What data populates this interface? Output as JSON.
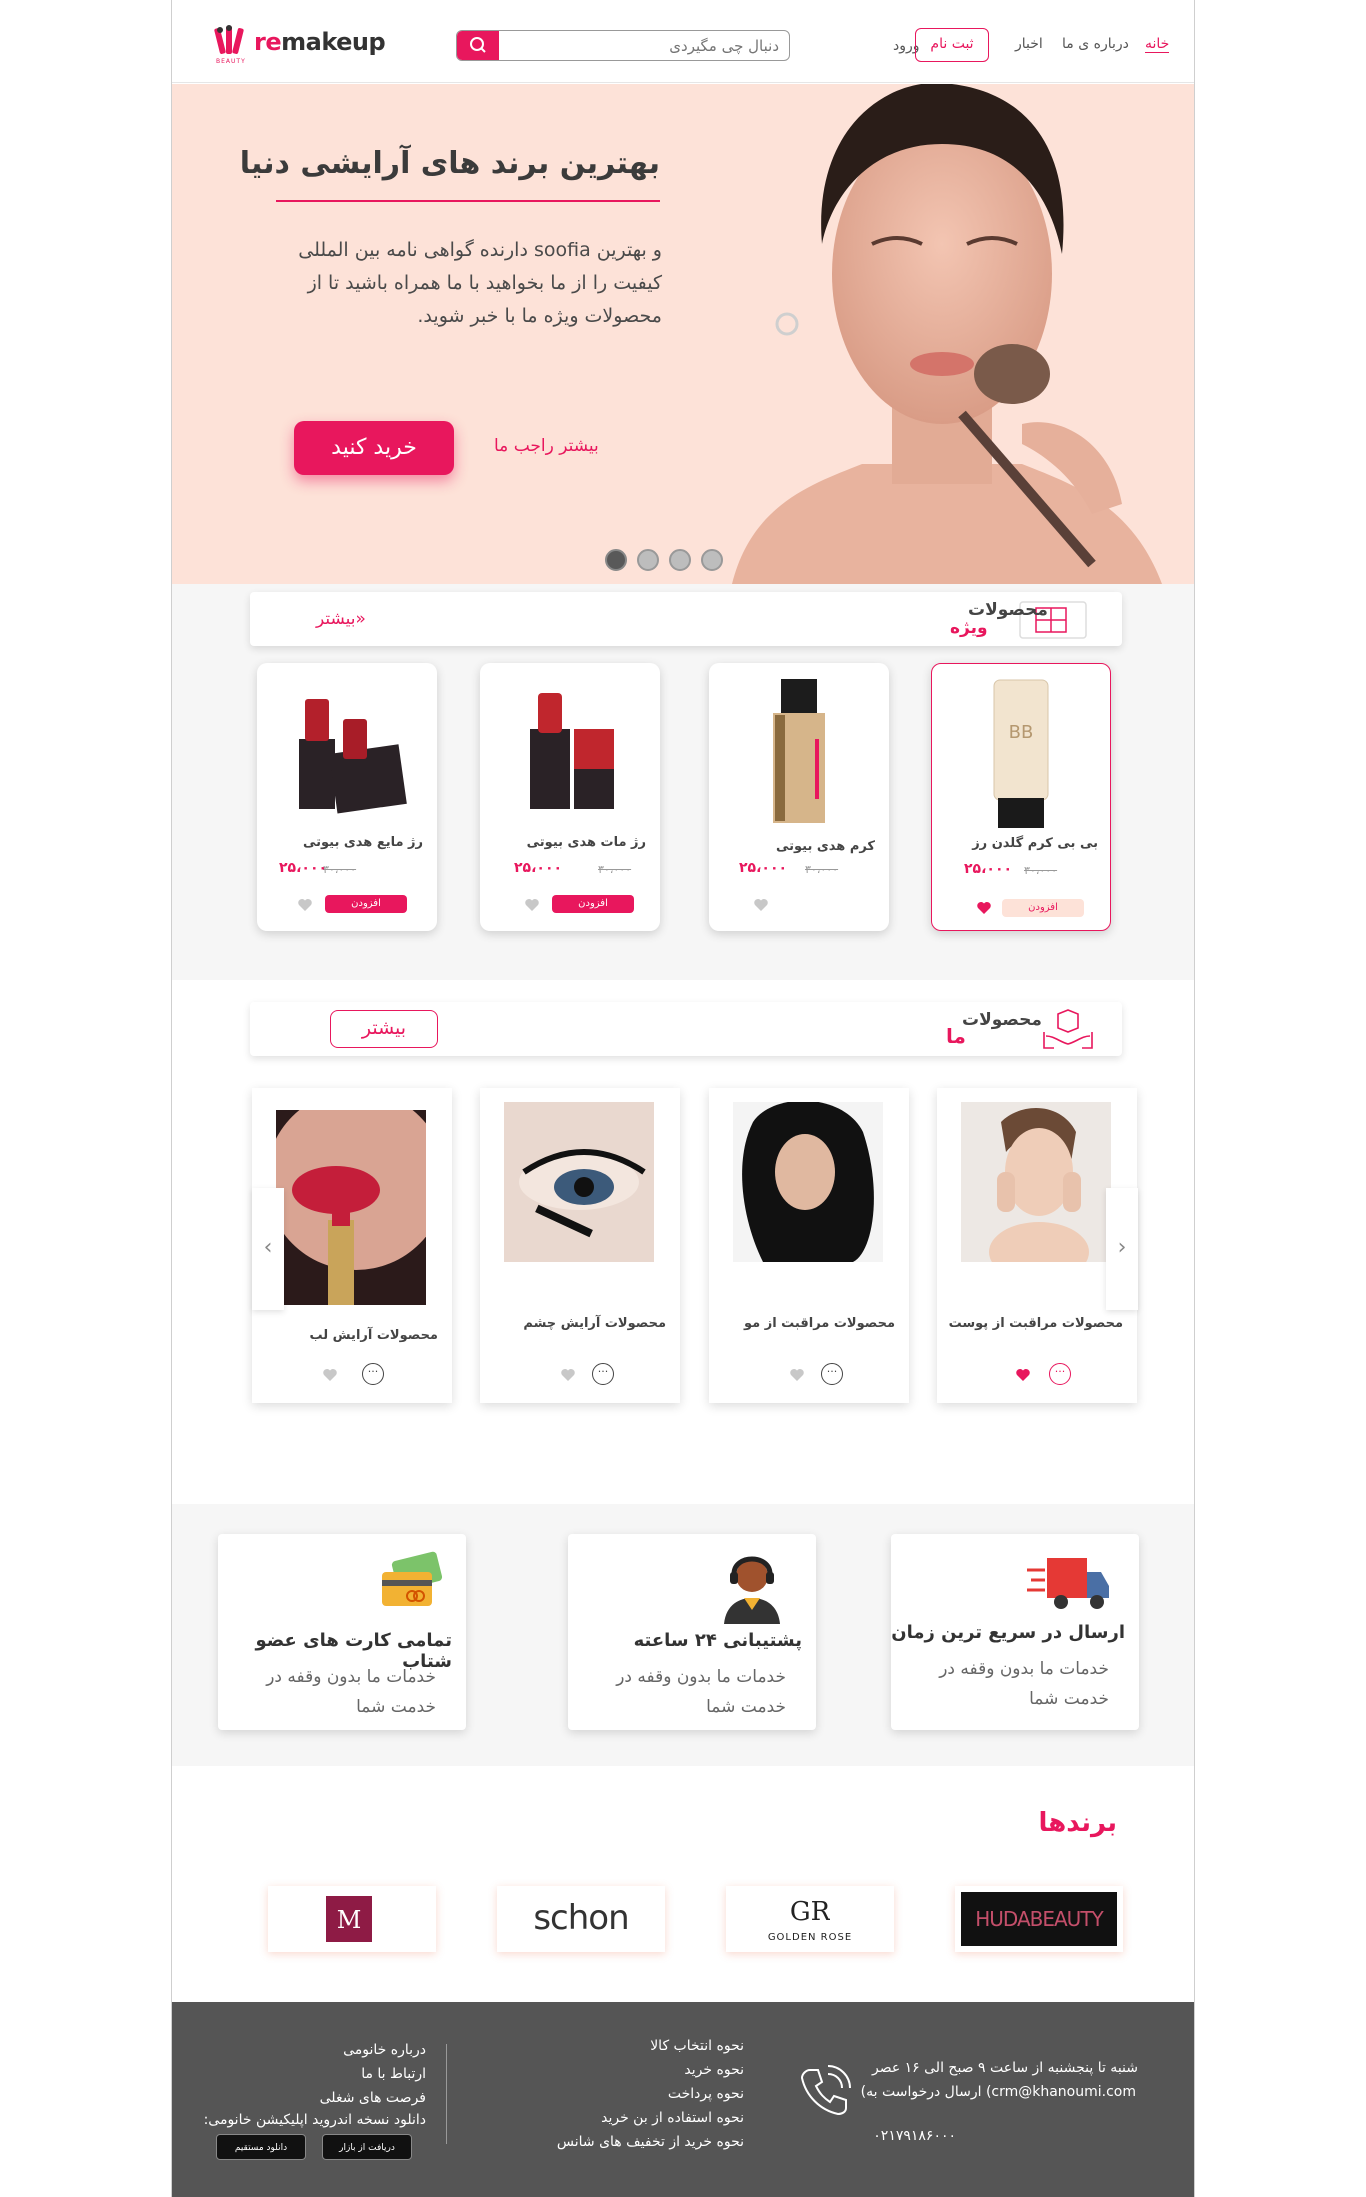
{
  "header": {
    "logo_re": "re",
    "logo_rest": "makeup",
    "logo_sub": "BEAUTY",
    "search_placeholder": "دنبال چی مگیردی",
    "nav": {
      "home": "خانه",
      "about": "درباره ی ما",
      "news": "اخبار",
      "signup": "ثبت نام",
      "login": "ورود"
    }
  },
  "hero": {
    "title": "بهترین برند های آرایشی دنیا",
    "description": "و بهترین soofia دارنده گواهی نامه بین المللی کیفیت را از ما بخواهید با ما همراه باشید تا از محصولات ویژه ما با خبر شوید.",
    "buy_button": "خرید کنید",
    "more_link": "بیشتر راجب ما",
    "slides": 4,
    "active_slide": 1
  },
  "special": {
    "title_1": "محصولات",
    "title_2": "ویژه",
    "more": "بیشتر»",
    "products": [
      {
        "name": "رژ مایع هدی بیوتی",
        "old_price": "۳۰،۰۰۰",
        "new_price": "۲۵،۰۰۰",
        "add": "افزودن",
        "liked": false
      },
      {
        "name": "رژ مات هدی بیوتی",
        "old_price": "۳۰،۰۰۰",
        "new_price": "۲۵،۰۰۰",
        "add": "افزودن",
        "liked": false
      },
      {
        "name": "کرم هدی بیوتی",
        "old_price": "۳۰،۰۰۰",
        "new_price": "۲۵،۰۰۰",
        "add": "",
        "liked": false
      },
      {
        "name": "بی بی کرم گلدن رز",
        "old_price": "۳۰،۰۰۰",
        "new_price": "۲۵،۰۰۰",
        "add": "افزودن",
        "liked": true
      }
    ]
  },
  "ours": {
    "title_1": "محصولات",
    "title_2": "ما",
    "more": "بیشتر",
    "categories": [
      {
        "name": "محصولات آرایش لب",
        "liked": false
      },
      {
        "name": "محصولات آرایش چشم",
        "liked": false
      },
      {
        "name": "محصولات مراقبت از مو",
        "liked": false
      },
      {
        "name": "محصولات مراقبت از پوست",
        "liked": true
      }
    ],
    "more_glyph": "···",
    "prev": "‹",
    "next": "›"
  },
  "features": [
    {
      "title": "تمامی کارت های عضو شتاب",
      "desc": "خدمات ما بدون وقفه در خدمت شما"
    },
    {
      "title": "پشتیبانی ۲۴ ساعته",
      "desc": "خدمات ما بدون وقفه در خدمت شما"
    },
    {
      "title": "ارسال در سریع ترین زمان",
      "desc": "خدمات ما بدون وقفه در خدمت شما"
    }
  ],
  "brands": {
    "title": "برندها",
    "items": [
      "M",
      "schon",
      "GOLDEN ROSE",
      "HUDABEAUTY"
    ]
  },
  "footer": {
    "contact": {
      "hours": "شنبه تا پنجشنبه از ساعت ۹ صبح الی ۱۶ عصر",
      "email": "crm@khanoumi.com) ارسال درخواست به)",
      "phone": "۰۲۱۷۹۱۸۶۰۰۰"
    },
    "guide": [
      "نحوه انتخاب کالا",
      "نحوه خرید",
      "نحوه پرداخت",
      "نحوه استفاده از بن خرید",
      "نحوه خرید از تخفیف های شانس"
    ],
    "about": [
      "درباره خانومی",
      "ارتباط با ما",
      "فرصت های شغلی",
      "دانلود نسخه اندروید اپلیکیشن خانومی:"
    ],
    "app_direct": "دانلود مستقیم",
    "app_bazaar": "دریافت از بازار"
  },
  "colors": {
    "accent": "#e8175d",
    "hero_bg": "#fde2d8",
    "footer_bg": "#555555"
  }
}
